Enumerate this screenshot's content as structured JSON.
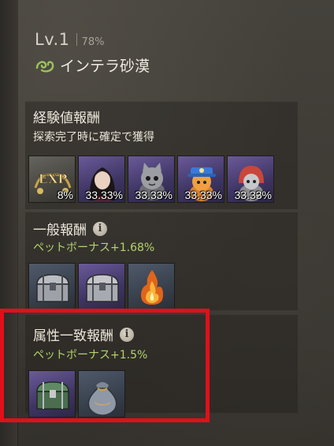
{
  "header": {
    "level": "Lv.1",
    "level_percent": "78%",
    "area_icon": "green-swirl-icon",
    "area_name": "インテラ砂漠"
  },
  "exp_rewards": {
    "title": "経験値報酬",
    "subtitle": "探索完了時に確定で獲得",
    "items": [
      {
        "icon": "exp-icon",
        "label": "8%",
        "exp_text": "EXP"
      },
      {
        "icon": "dark-hair-character-icon",
        "label": "33.33%"
      },
      {
        "icon": "grey-cat-pet-icon",
        "label": "33.33%"
      },
      {
        "icon": "blue-hat-pet-icon",
        "label": "33.33%"
      },
      {
        "icon": "red-hood-cat-pet-icon",
        "label": "33.33%"
      }
    ]
  },
  "general_rewards": {
    "title": "一般報酬",
    "info_glyph": "i",
    "bonus": "ペットボーナス+1.68%",
    "items": [
      {
        "icon": "silver-chest-icon"
      },
      {
        "icon": "silver-chest-purple-icon"
      },
      {
        "icon": "flame-icon"
      }
    ]
  },
  "attribute_rewards": {
    "title": "属性一致報酬",
    "info_glyph": "i",
    "bonus": "ペットボーナス+1.5%",
    "items": [
      {
        "icon": "green-chest-icon"
      },
      {
        "icon": "pouch-icon"
      }
    ]
  },
  "colors": {
    "bonus_green": "#b4d36a",
    "highlight_red": "#e0101a",
    "rare_purple": "#4a3f74"
  }
}
